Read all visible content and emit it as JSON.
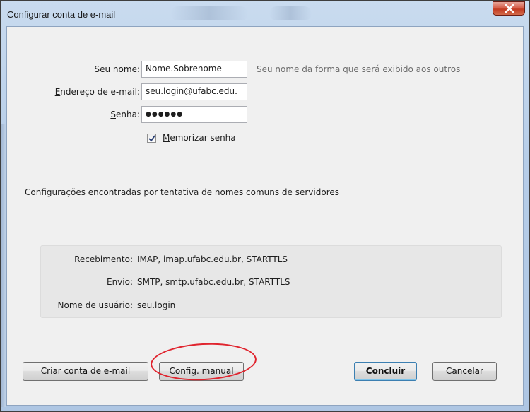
{
  "window": {
    "title": "Configurar conta de e-mail"
  },
  "form": {
    "name_label_pre": "Seu ",
    "name_label_u": "n",
    "name_label_post": "ome:",
    "name_value": "Nome.Sobrenome",
    "name_hint": "Seu nome da forma que será exibido aos outros",
    "email_label_u": "E",
    "email_label_post": "ndereço de e-mail:",
    "email_value": "seu.login@ufabc.edu.",
    "password_label_u": "S",
    "password_label_post": "enha:",
    "password_value": "●●●●●●",
    "remember_label_u": "M",
    "remember_label_post": "emorizar senha",
    "remember_checked": true
  },
  "status_text": "Configurações encontradas por tentativa de nomes comuns de servidores",
  "server_info": {
    "incoming_label": "Recebimento:",
    "incoming_value": "IMAP, imap.ufabc.edu.br, STARTTLS",
    "outgoing_label": "Envio:",
    "outgoing_value": "SMTP, smtp.ufabc.edu.br, STARTTLS",
    "username_label": "Nome de usuário:",
    "username_value": "seu.login"
  },
  "buttons": {
    "create_pre": "C",
    "create_u": "r",
    "create_post": "iar conta de e-mail",
    "manual_pre": "C",
    "manual_u": "o",
    "manual_post": "nfig. manual",
    "done_u": "C",
    "done_post": "oncluir",
    "cancel_pre": "C",
    "cancel_u": "a",
    "cancel_post": "ncelar"
  },
  "colors": {
    "annotation": "#e0242e",
    "close_button": "#c23b22"
  }
}
